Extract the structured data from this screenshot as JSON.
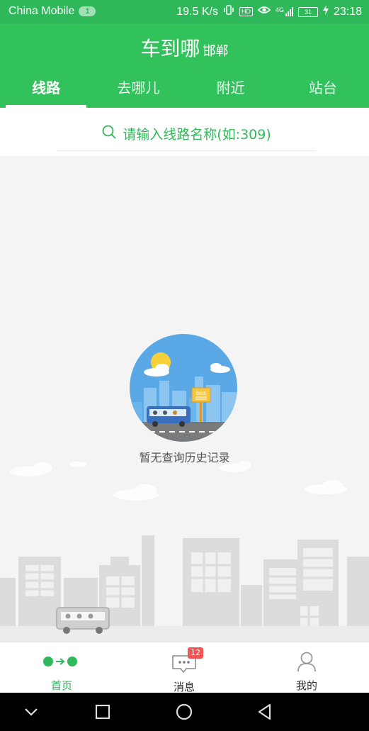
{
  "status_bar": {
    "carrier": "China Mobile",
    "sim_badge": "1",
    "net_speed": "19.5 K/s",
    "hd_label": "HD",
    "net_type": "4G",
    "battery": "31",
    "time": "23:18"
  },
  "header": {
    "app_title": "车到哪",
    "city": "邯郸"
  },
  "tabs": [
    {
      "label": "线路",
      "active": true
    },
    {
      "label": "去哪儿",
      "active": false
    },
    {
      "label": "附近",
      "active": false
    },
    {
      "label": "站台",
      "active": false
    }
  ],
  "search": {
    "placeholder": "请输入线路名称(如:309)"
  },
  "empty_state": {
    "message": "暂无查询历史记录",
    "sign_text": "bus"
  },
  "bottom_nav": {
    "items": [
      {
        "label": "首页",
        "icon": "route-dots-icon",
        "active": true
      },
      {
        "label": "消息",
        "icon": "message-icon",
        "badge": "12",
        "active": false
      },
      {
        "label": "我的",
        "icon": "user-icon",
        "active": false
      }
    ]
  },
  "colors": {
    "primary_green": "#31c25c",
    "badge_red": "#f05454"
  }
}
